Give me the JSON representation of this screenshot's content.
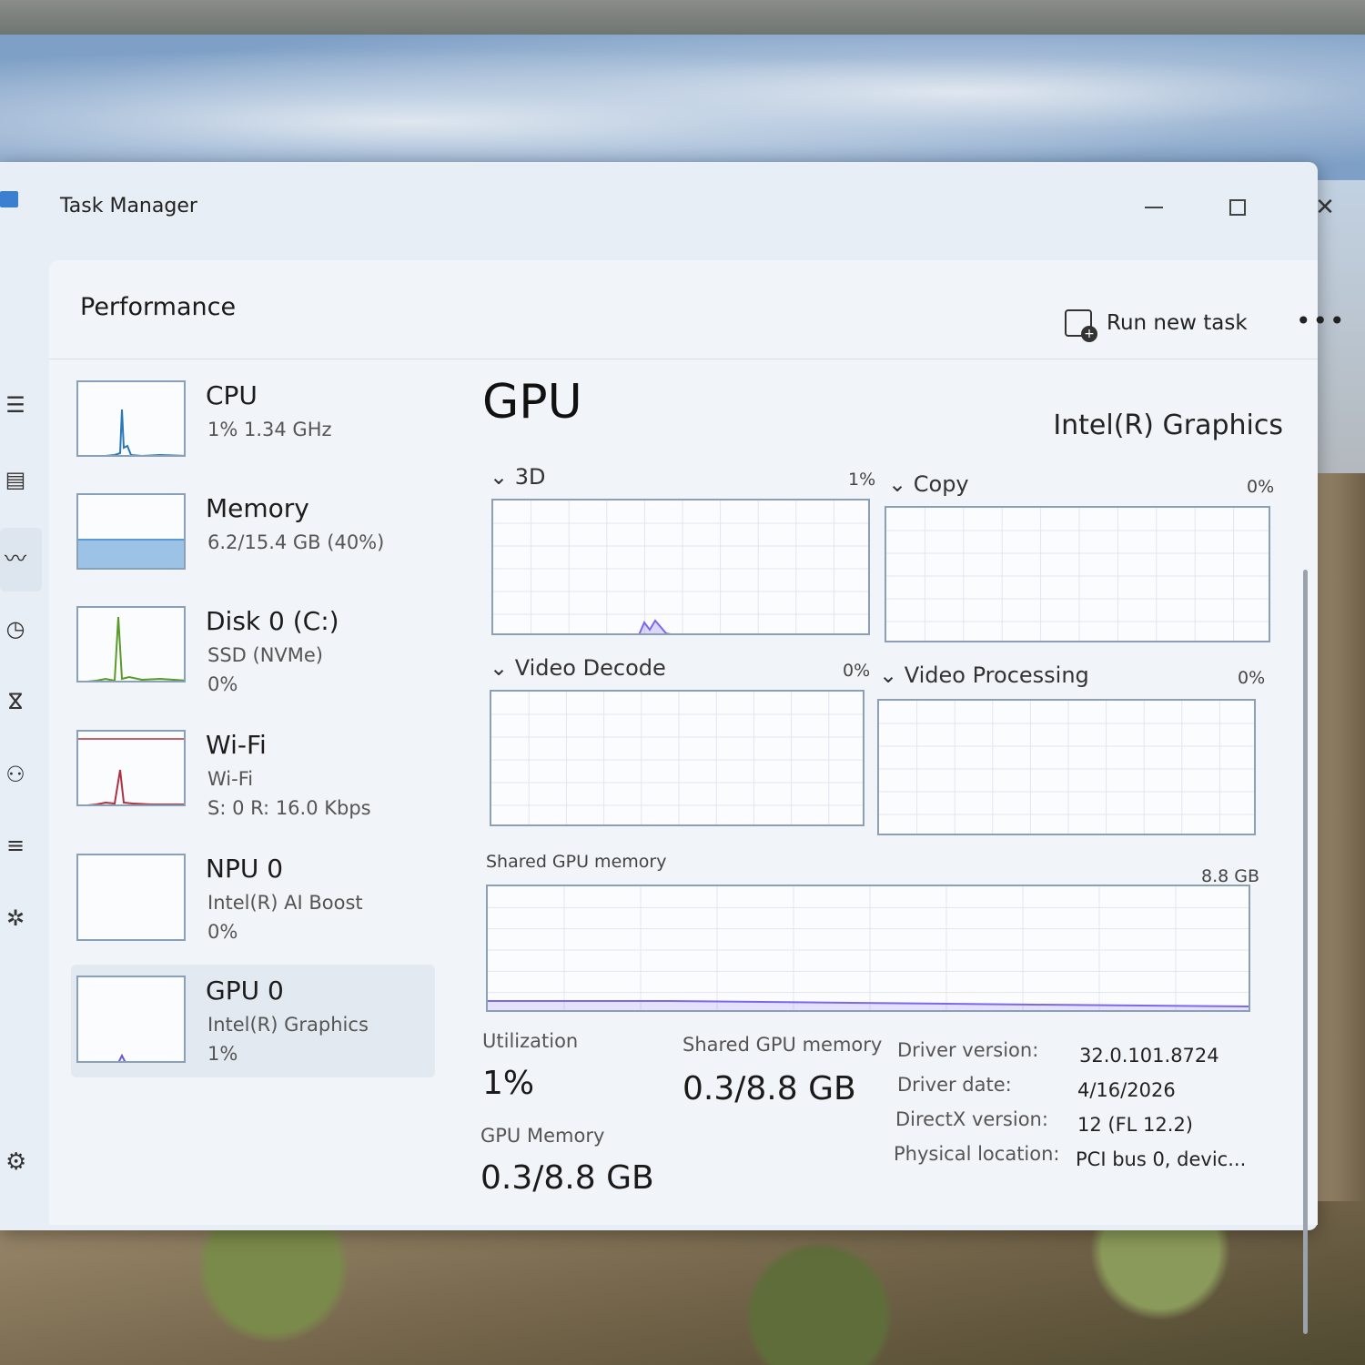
{
  "window": {
    "title": "Task Manager"
  },
  "header": {
    "page_title": "Performance",
    "run_new_task": "Run new task",
    "more": "•••"
  },
  "rail_icons": [
    "menu-icon",
    "processes-icon",
    "performance-icon",
    "app-history-icon",
    "startup-icon",
    "users-icon",
    "details-icon",
    "services-icon",
    "settings-icon"
  ],
  "list": {
    "items": [
      {
        "title": "CPU",
        "sub1": "1%  1.34 GHz",
        "sub2": "",
        "color": "#2a78b8"
      },
      {
        "title": "Memory",
        "sub1": "6.2/15.4 GB (40%)",
        "sub2": "",
        "color": "#5b9bd5",
        "fill_fraction": 0.4
      },
      {
        "title": "Disk 0 (C:)",
        "sub1": "SSD (NVMe)",
        "sub2": "0%",
        "color": "#5a9a2a"
      },
      {
        "title": "Wi-Fi",
        "sub1": "Wi-Fi",
        "sub2": "S: 0  R: 16.0 Kbps",
        "color": "#b03040"
      },
      {
        "title": "NPU 0",
        "sub1": "Intel(R) AI Boost",
        "sub2": "0%",
        "color": "#2a78b8"
      },
      {
        "title": "GPU 0",
        "sub1": "Intel(R) Graphics",
        "sub2": "1%",
        "color": "#6a5acd"
      }
    ]
  },
  "detail": {
    "title": "GPU",
    "device_name": "Intel(R) Graphics",
    "engines": [
      {
        "name": "3D",
        "percent": "1%"
      },
      {
        "name": "Copy",
        "percent": "0%"
      },
      {
        "name": "Video Decode",
        "percent": "0%"
      },
      {
        "name": "Video Processing",
        "percent": "0%"
      }
    ],
    "shared_memory_label": "Shared GPU memory",
    "shared_memory_max": "8.8 GB",
    "stats": {
      "utilization_label": "Utilization",
      "utilization_value": "1%",
      "shared_label": "Shared GPU memory",
      "shared_value": "0.3/8.8 GB",
      "gpu_memory_label": "GPU Memory",
      "gpu_memory_value": "0.3/8.8 GB"
    },
    "info": [
      {
        "label": "Driver version:",
        "value": "32.0.101.8724"
      },
      {
        "label": "Driver date:",
        "value": "4/16/2026"
      },
      {
        "label": "DirectX version:",
        "value": "12 (FL 12.2)"
      },
      {
        "label": "Physical location:",
        "value": "PCI bus 0, devic..."
      }
    ]
  },
  "colors": {
    "gpu_line": "#7b68ee",
    "graph_border": "#8c9fb4",
    "window_bg": "#e8eef5"
  }
}
